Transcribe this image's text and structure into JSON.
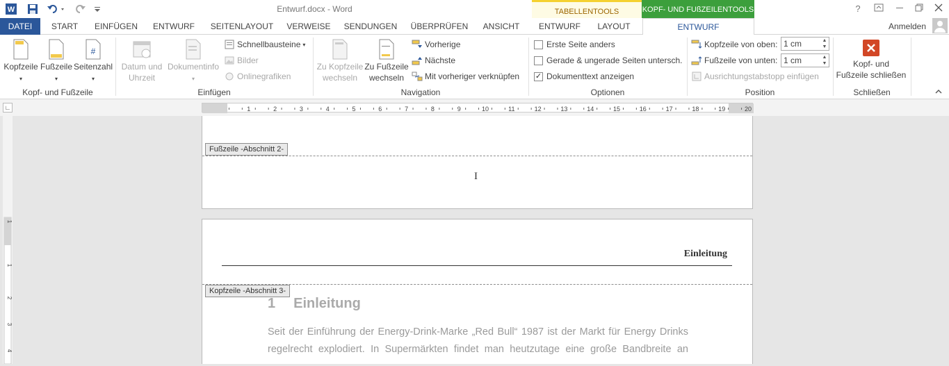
{
  "window": {
    "title": "Entwurf.docx - Word",
    "contextual_tabs": {
      "table_tools": "TABELLENTOOLS",
      "header_footer_tools": "KOPF- UND FUßZEILENTOOLS"
    },
    "sign_in": "Anmelden",
    "help": "?"
  },
  "tabs": {
    "file": "DATEI",
    "start": "START",
    "insert": "EINFÜGEN",
    "design": "ENTWURF",
    "page_layout": "SEITENLAYOUT",
    "references": "VERWEISE",
    "mailings": "SENDUNGEN",
    "review": "ÜBERPRÜFEN",
    "view": "ANSICHT",
    "table_design": "ENTWURF",
    "table_layout": "LAYOUT",
    "hf_design": "ENTWURF"
  },
  "ribbon": {
    "group_hf": {
      "label": "Kopf- und Fußzeile",
      "header": "Kopfzeile",
      "footer": "Fußzeile",
      "page_number": "Seitenzahl"
    },
    "group_insert": {
      "label": "Einfügen",
      "date_line1": "Datum und",
      "date_line2": "Uhrzeit",
      "docinfo": "Dokumentinfo",
      "quick_parts": "Schnellbausteine",
      "pictures": "Bilder",
      "online_pictures": "Onlinegrafiken"
    },
    "group_nav": {
      "label": "Navigation",
      "goto_header_line1": "Zu Kopfzeile",
      "goto_header_line2": "wechseln",
      "goto_footer_line1": "Zu Fußzeile",
      "goto_footer_line2": "wechseln",
      "previous": "Vorherige",
      "next": "Nächste",
      "link_previous": "Mit vorheriger verknüpfen"
    },
    "group_options": {
      "label": "Optionen",
      "different_first": "Erste Seite anders",
      "different_odd_even": "Gerade & ungerade Seiten untersch.",
      "show_doc_text": "Dokumenttext anzeigen",
      "different_first_checked": false,
      "different_odd_even_checked": false,
      "show_doc_text_checked": true
    },
    "group_position": {
      "label": "Position",
      "header_from_top_label": "Kopfzeile von oben:",
      "header_from_top_value": "1  cm",
      "footer_from_bottom_label": "Fußzeile von unten:",
      "footer_from_bottom_value": "1  cm",
      "insert_alignment_tab": "Ausrichtungstabstopp einfügen"
    },
    "group_close": {
      "label": "Schließen",
      "close_line1": "Kopf- und",
      "close_line2": "Fußzeile schließen"
    }
  },
  "ruler": {
    "marks": [
      "1",
      "2",
      "3",
      "4",
      "5",
      "6",
      "7",
      "8",
      "9",
      "10",
      "11",
      "12",
      "13",
      "14",
      "15",
      "16",
      "17",
      "18",
      "19",
      "20"
    ],
    "vmarks": [
      "1",
      "1",
      "2",
      "3",
      "4"
    ]
  },
  "document": {
    "footer_tag": "Fußzeile -Abschnitt 2-",
    "header_tag": "Kopfzeile -Abschnitt 3-",
    "header_text": "Einleitung",
    "heading_number": "1",
    "heading_text": "Einleitung",
    "body_line1": "Seit der Einführung der Energy-Drink-Marke „Red Bull“ 1987 ist der Markt für Energy Drinks",
    "body_line2": "regelrecht explodiert. In Supermärkten findet man heutzutage eine große Bandbreite an"
  },
  "colors": {
    "accent": "#2b579a",
    "ctx_table": "#f5d130",
    "ctx_hf": "#3c9f3c",
    "close_red": "#d24726"
  }
}
